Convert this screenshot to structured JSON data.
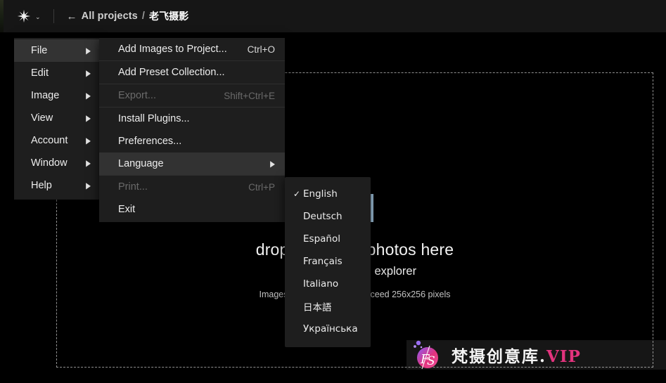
{
  "header": {
    "brand_icon": "sparkle-icon",
    "brand_chevron": "⌄",
    "breadcrumb": {
      "back_arrow": "←",
      "projects_label": "All projects",
      "separator": "/",
      "project_name": "老飞摄影"
    }
  },
  "dropzone": {
    "icon": "download-box-icon",
    "title": "drop folders or photos here",
    "subtitle": "or click to open explorer",
    "note": "Images' resolution should exceed 256x256 pixels",
    "icon_color": "#a9cde9",
    "border_color": "#8f8f8f"
  },
  "menubar": {
    "items": [
      {
        "label": "File",
        "arrow": "▶",
        "active": true
      },
      {
        "label": "Edit",
        "arrow": "▶",
        "active": false
      },
      {
        "label": "Image",
        "arrow": "▶",
        "active": false
      },
      {
        "label": "View",
        "arrow": "▶",
        "active": false
      },
      {
        "label": "Account",
        "arrow": "▶",
        "active": false
      },
      {
        "label": "Window",
        "arrow": "▶",
        "active": false
      },
      {
        "label": "Help",
        "arrow": "▶",
        "active": false
      }
    ]
  },
  "file_menu": {
    "items": [
      {
        "label": "Add Images to Project...",
        "accel": "Ctrl+O",
        "disabled": false,
        "highlight": false,
        "submenu": false
      },
      {
        "label": "Add Preset Collection...",
        "accel": "",
        "disabled": false,
        "highlight": false,
        "submenu": false
      },
      {
        "label": "Export...",
        "accel": "Shift+Ctrl+E",
        "disabled": true,
        "highlight": false,
        "submenu": false
      },
      {
        "label": "Install Plugins...",
        "accel": "",
        "disabled": false,
        "highlight": false,
        "submenu": false
      },
      {
        "label": "Preferences...",
        "accel": "",
        "disabled": false,
        "highlight": false,
        "submenu": false
      },
      {
        "label": "Language",
        "accel": "",
        "disabled": false,
        "highlight": true,
        "submenu": true,
        "submenu_arrow": "▶"
      },
      {
        "label": "Print...",
        "accel": "Ctrl+P",
        "disabled": true,
        "highlight": false,
        "submenu": false
      },
      {
        "label": "Exit",
        "accel": "",
        "disabled": false,
        "highlight": false,
        "submenu": false
      }
    ],
    "separators_after": [
      0,
      1,
      2,
      5
    ]
  },
  "language_menu": {
    "check_glyph": "✓",
    "items": [
      {
        "label": "English",
        "checked": true
      },
      {
        "label": "Deutsch",
        "checked": false
      },
      {
        "label": "Español",
        "checked": false
      },
      {
        "label": "Français",
        "checked": false
      },
      {
        "label": "Italiano",
        "checked": false
      },
      {
        "label": "日本語",
        "checked": false
      },
      {
        "label": "Українська",
        "checked": false
      }
    ]
  },
  "watermark": {
    "logo_text": "FS",
    "text_cn": "梵摄创意库",
    "dot": ".",
    "text_vip": "VIP",
    "accent": "#e2337d"
  }
}
